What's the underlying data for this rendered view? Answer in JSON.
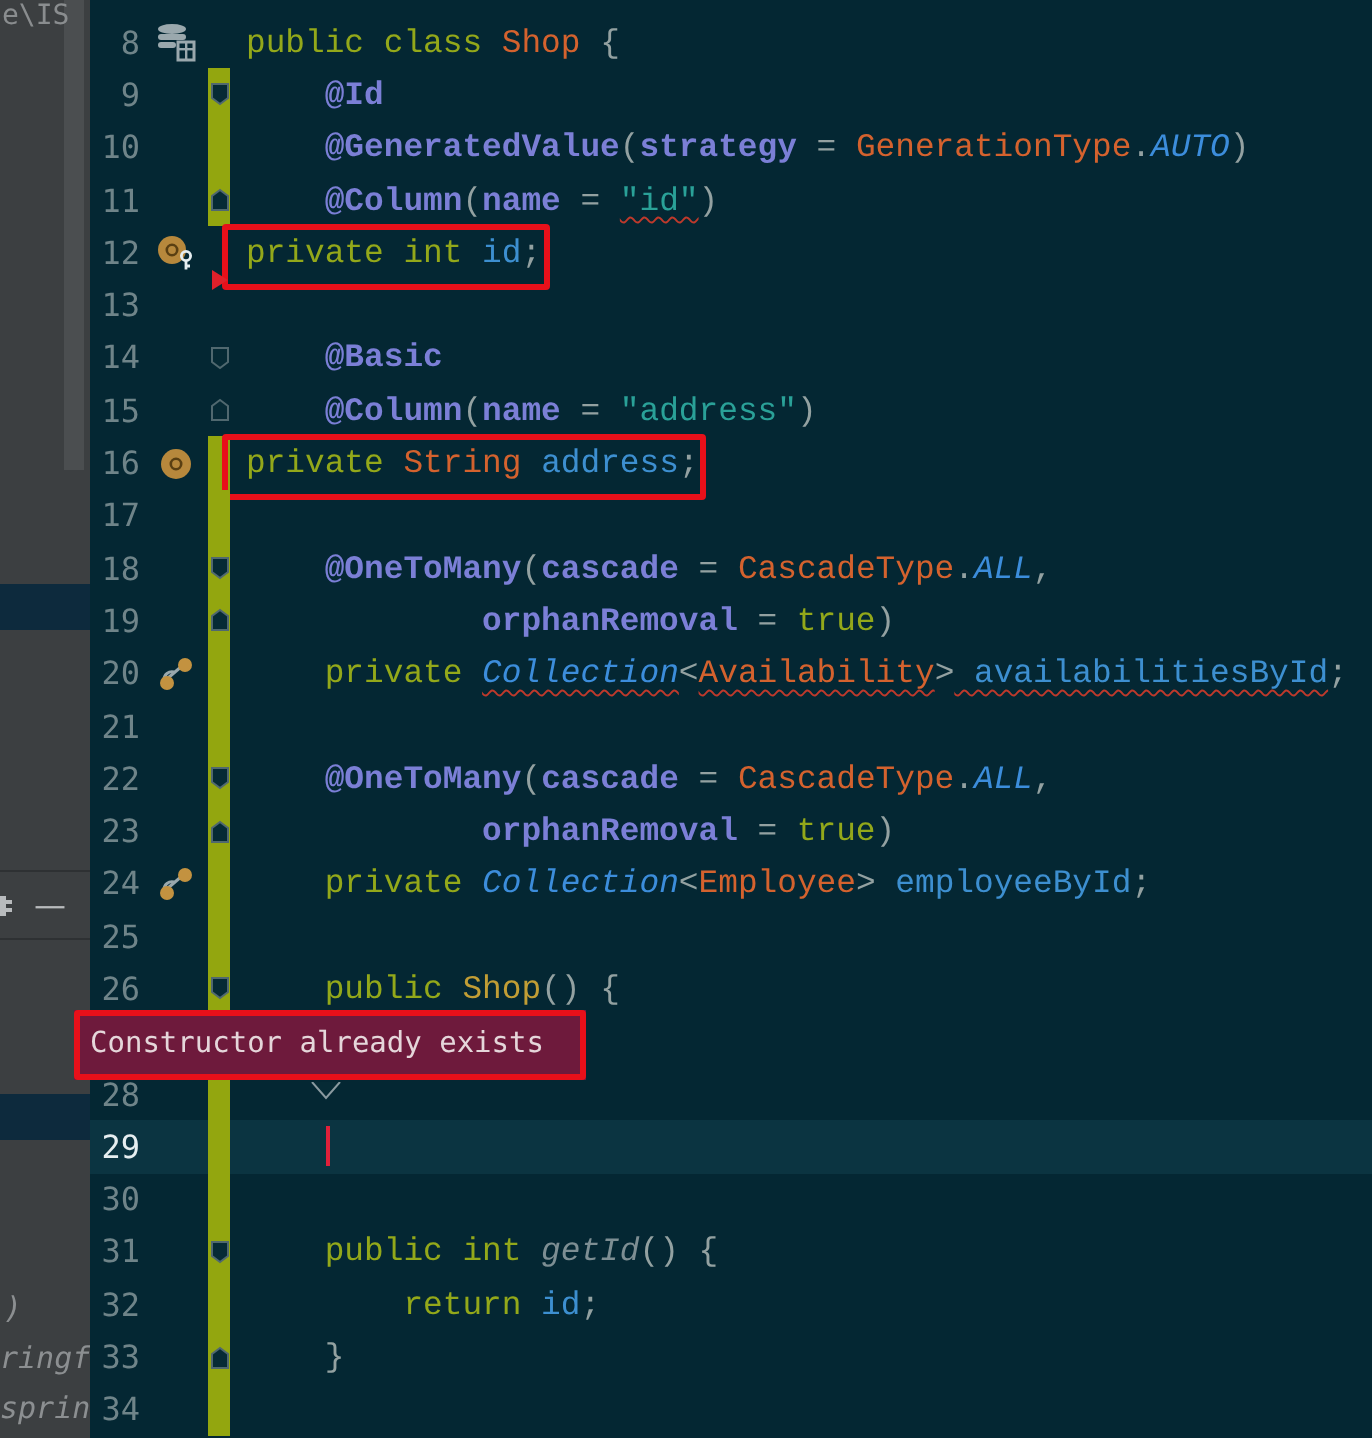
{
  "left_panel": {
    "path_fragment": "e\\IS",
    "toolbar_icon": "—",
    "fragments": [
      ")",
      "ringf",
      "sprin"
    ]
  },
  "editor": {
    "lines": [
      {
        "number": "8",
        "gutter_icon": {
          "kind": "database"
        },
        "tokens": [
          {
            "text": "public class ",
            "kind": "keyword"
          },
          {
            "text": "Shop",
            "kind": "class"
          },
          {
            "text": " {",
            "kind": "punct"
          }
        ]
      },
      {
        "number": "9",
        "fold_marker": {
          "kind": "start"
        },
        "changed": true,
        "tokens": [
          {
            "text": "    @Id",
            "kind": "annotation"
          }
        ]
      },
      {
        "number": "10",
        "changed": true,
        "tokens": [
          {
            "text": "    @GeneratedValue",
            "kind": "annotation"
          },
          {
            "text": "(",
            "kind": "punct"
          },
          {
            "text": "strategy",
            "kind": "annotation"
          },
          {
            "text": " = ",
            "kind": "punct"
          },
          {
            "text": "GenerationType",
            "kind": "type"
          },
          {
            "text": ".",
            "kind": "punct"
          },
          {
            "text": "AUTO",
            "kind": "constant"
          },
          {
            "text": ")",
            "kind": "punct"
          }
        ]
      },
      {
        "number": "11",
        "fold_marker": {
          "kind": "end"
        },
        "changed": true,
        "tokens": [
          {
            "text": "    @Column",
            "kind": "annotation"
          },
          {
            "text": "(",
            "kind": "punct"
          },
          {
            "text": "name",
            "kind": "annotation"
          },
          {
            "text": " = ",
            "kind": "punct"
          },
          {
            "text": "\"id\"",
            "kind": "string",
            "warn": true
          },
          {
            "text": ")",
            "kind": "punct"
          }
        ]
      },
      {
        "number": "12",
        "gutter_icon": {
          "kind": "field-key"
        },
        "boxed": true,
        "tokens": [
          {
            "text": "private int ",
            "kind": "keyword"
          },
          {
            "text": "id",
            "kind": "field"
          },
          {
            "text": ";",
            "kind": "punct"
          }
        ]
      },
      {
        "number": "13",
        "fold_marker": {
          "kind": "arrow"
        }
      },
      {
        "number": "14",
        "fold_marker": {
          "kind": "start"
        },
        "tokens": [
          {
            "text": "    @Basic",
            "kind": "annotation"
          }
        ]
      },
      {
        "number": "15",
        "fold_marker": {
          "kind": "end"
        },
        "tokens": [
          {
            "text": "    @Column",
            "kind": "annotation"
          },
          {
            "text": "(",
            "kind": "punct"
          },
          {
            "text": "name",
            "kind": "annotation"
          },
          {
            "text": " = ",
            "kind": "punct"
          },
          {
            "text": "\"address\"",
            "kind": "string"
          },
          {
            "text": ")",
            "kind": "punct"
          }
        ]
      },
      {
        "number": "16",
        "gutter_icon": {
          "kind": "field"
        },
        "changed": true,
        "boxed": true,
        "tokens": [
          {
            "text": "private ",
            "kind": "keyword"
          },
          {
            "text": "String",
            "kind": "type"
          },
          {
            "text": " address",
            "kind": "field"
          },
          {
            "text": ";",
            "kind": "punct"
          }
        ]
      },
      {
        "number": "17",
        "changed": true
      },
      {
        "number": "18",
        "fold_marker": {
          "kind": "start"
        },
        "changed": true,
        "tokens": [
          {
            "text": "    @OneToMany",
            "kind": "annotation"
          },
          {
            "text": "(",
            "kind": "punct"
          },
          {
            "text": "cascade",
            "kind": "annotation"
          },
          {
            "text": " = ",
            "kind": "punct"
          },
          {
            "text": "CascadeType",
            "kind": "type"
          },
          {
            "text": ".",
            "kind": "punct"
          },
          {
            "text": "ALL",
            "kind": "constant"
          },
          {
            "text": ",",
            "kind": "punct"
          }
        ]
      },
      {
        "number": "19",
        "fold_marker": {
          "kind": "end"
        },
        "changed": true,
        "tokens": [
          {
            "text": "            orphanRemoval",
            "kind": "annotation"
          },
          {
            "text": " = ",
            "kind": "punct"
          },
          {
            "text": "true",
            "kind": "keyword"
          },
          {
            "text": ")",
            "kind": "punct"
          }
        ]
      },
      {
        "number": "20",
        "gutter_icon": {
          "kind": "link"
        },
        "changed": true,
        "tokens": [
          {
            "text": "    private ",
            "kind": "keyword"
          },
          {
            "text": "Collection",
            "kind": "generic",
            "warn": true
          },
          {
            "text": "<",
            "kind": "punct"
          },
          {
            "text": "Availability",
            "kind": "type",
            "warn": true
          },
          {
            "text": ">",
            "kind": "punct"
          },
          {
            "text": " availabilitiesById",
            "kind": "field",
            "warn": true
          },
          {
            "text": ";",
            "kind": "punct"
          }
        ]
      },
      {
        "number": "21",
        "changed": true
      },
      {
        "number": "22",
        "fold_marker": {
          "kind": "start"
        },
        "changed": true,
        "tokens": [
          {
            "text": "    @OneToMany",
            "kind": "annotation"
          },
          {
            "text": "(",
            "kind": "punct"
          },
          {
            "text": "cascade",
            "kind": "annotation"
          },
          {
            "text": " = ",
            "kind": "punct"
          },
          {
            "text": "CascadeType",
            "kind": "type"
          },
          {
            "text": ".",
            "kind": "punct"
          },
          {
            "text": "ALL",
            "kind": "constant"
          },
          {
            "text": ",",
            "kind": "punct"
          }
        ]
      },
      {
        "number": "23",
        "fold_marker": {
          "kind": "end"
        },
        "changed": true,
        "tokens": [
          {
            "text": "            orphanRemoval",
            "kind": "annotation"
          },
          {
            "text": " = ",
            "kind": "punct"
          },
          {
            "text": "true",
            "kind": "keyword"
          },
          {
            "text": ")",
            "kind": "punct"
          }
        ]
      },
      {
        "number": "24",
        "gutter_icon": {
          "kind": "link"
        },
        "changed": true,
        "tokens": [
          {
            "text": "    private ",
            "kind": "keyword"
          },
          {
            "text": "Collection",
            "kind": "generic"
          },
          {
            "text": "<",
            "kind": "punct"
          },
          {
            "text": "Employee",
            "kind": "type"
          },
          {
            "text": ">",
            "kind": "punct"
          },
          {
            "text": " employeeById",
            "kind": "field"
          },
          {
            "text": ";",
            "kind": "punct"
          }
        ]
      },
      {
        "number": "25",
        "changed": true
      },
      {
        "number": "26",
        "fold_marker": {
          "kind": "start"
        },
        "changed": true,
        "tokens": [
          {
            "text": "    public ",
            "kind": "keyword"
          },
          {
            "text": "Shop",
            "kind": "method"
          },
          {
            "text": "() {",
            "kind": "punct"
          }
        ]
      },
      {
        "tooltip": "Constructor already exists"
      },
      {
        "number": "28",
        "changed": true
      },
      {
        "number": "29",
        "changed": true,
        "current": true
      },
      {
        "number": "30",
        "changed": true
      },
      {
        "number": "31",
        "fold_marker": {
          "kind": "start"
        },
        "changed": true,
        "tokens": [
          {
            "text": "    public int ",
            "kind": "keyword"
          },
          {
            "text": "getId",
            "kind": "imethod"
          },
          {
            "text": "() {",
            "kind": "punct"
          }
        ]
      },
      {
        "number": "32",
        "changed": true,
        "tokens": [
          {
            "text": "        return ",
            "kind": "keyword"
          },
          {
            "text": "id",
            "kind": "field"
          },
          {
            "text": ";",
            "kind": "punct"
          }
        ]
      },
      {
        "number": "33",
        "fold_marker": {
          "kind": "end"
        },
        "changed": true,
        "tokens": [
          {
            "text": "    }",
            "kind": "punct"
          }
        ]
      },
      {
        "number": "34",
        "changed": true
      }
    ]
  }
}
